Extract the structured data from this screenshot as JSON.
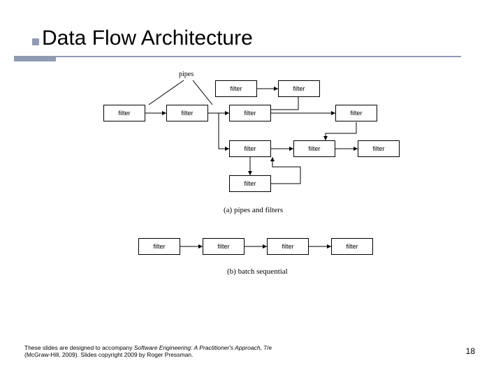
{
  "title": "Data Flow Architecture",
  "diagram": {
    "pipes_label": "pipes",
    "filter_label": "filter",
    "caption_a": "(a) pipes and filters",
    "caption_b": "(b) batch sequential"
  },
  "footer": {
    "line1_prefix": "These slides are designed to accompany ",
    "line1_title": "Software Engineering: A Practitioner's Approach,",
    "line1_suffix": " 7/e ",
    "line2": "(McGraw-Hill, 2009). Slides copyright 2009 by Roger Pressman."
  },
  "slide_number": "18"
}
